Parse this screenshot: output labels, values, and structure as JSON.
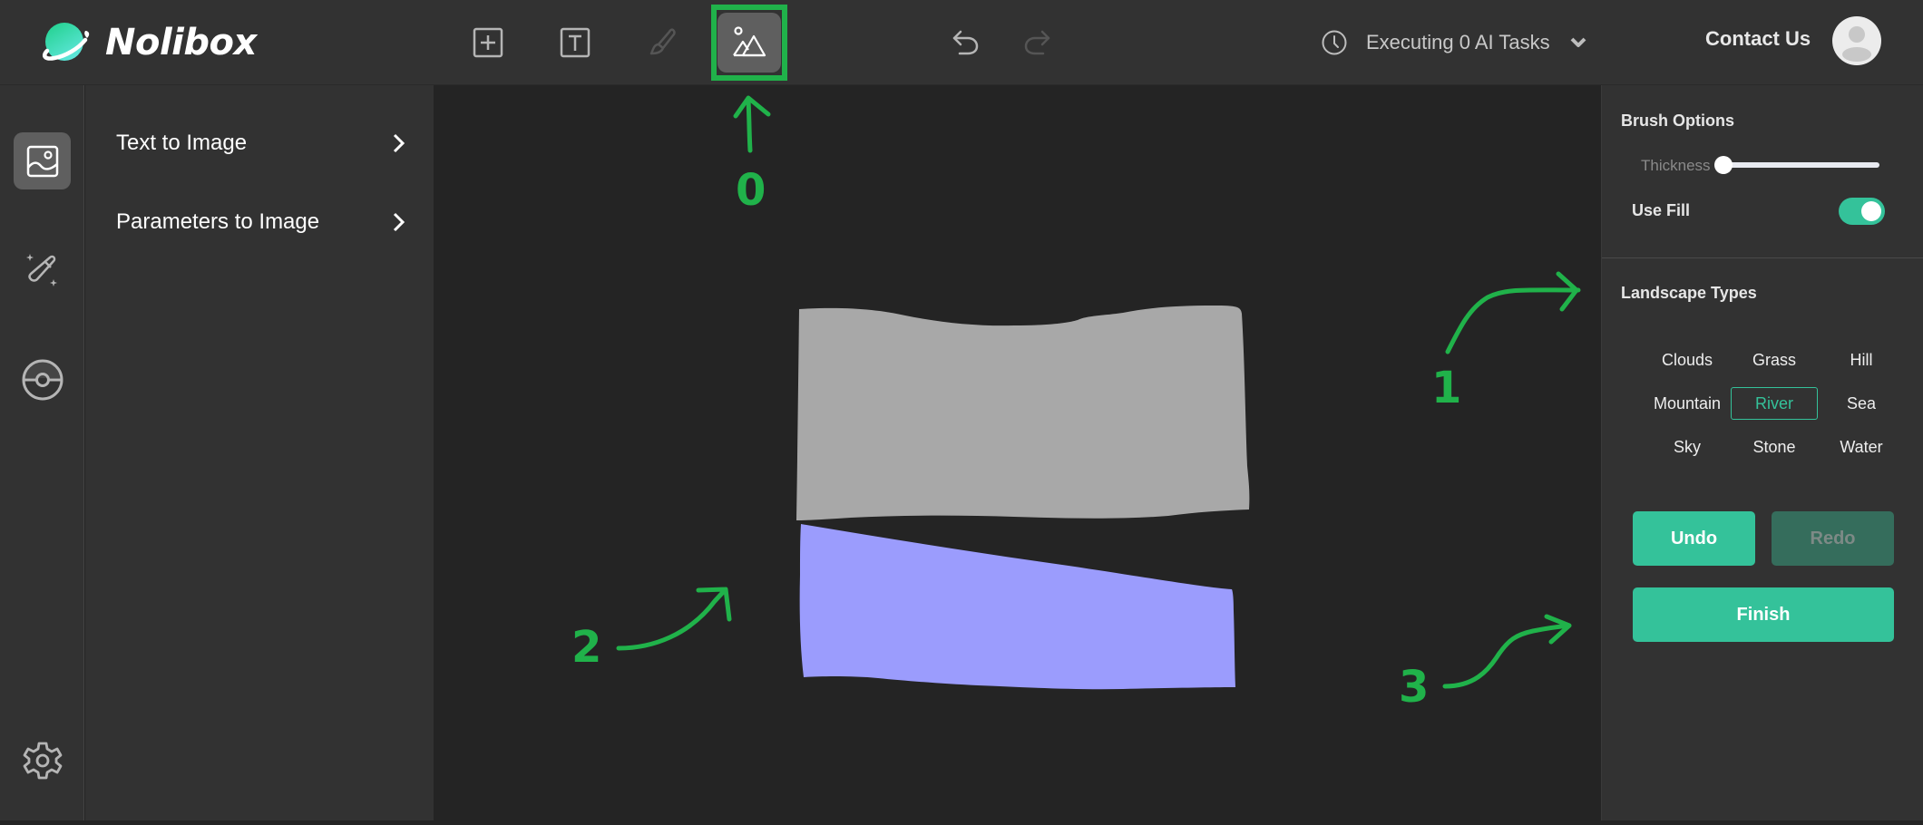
{
  "app": {
    "name": "Nolibox"
  },
  "toolbar": {
    "tools": [
      {
        "name": "add",
        "icon": "plus-square-icon",
        "active": false,
        "enabled": true
      },
      {
        "name": "text",
        "icon": "text-box-icon",
        "active": false,
        "enabled": true
      },
      {
        "name": "brush",
        "icon": "brush-icon",
        "active": false,
        "enabled": false
      },
      {
        "name": "landscape",
        "icon": "landscape-icon",
        "active": true,
        "enabled": true
      }
    ],
    "undo_icon": "undo-icon",
    "redo_icon": "redo-icon"
  },
  "header": {
    "tasks_label": "Executing 0 AI Tasks",
    "contact_label": "Contact Us"
  },
  "rail": {
    "items": [
      {
        "icon": "image-icon",
        "active": true
      },
      {
        "icon": "magic-wand-icon",
        "active": false
      },
      {
        "icon": "pokeball-icon",
        "active": false
      }
    ],
    "settings_icon": "gear-icon"
  },
  "left_panel": {
    "items": [
      {
        "label": "Text to Image"
      },
      {
        "label": "Parameters to Image"
      }
    ]
  },
  "canvas": {
    "shapes": [
      {
        "type": "Mountain",
        "color": "#a8a8a8"
      },
      {
        "type": "River",
        "color": "#9b9cfd"
      }
    ]
  },
  "right_panel": {
    "brush_title": "Brush Options",
    "thickness_label": "Thickness",
    "thickness_value_fraction": 0.0,
    "use_fill_label": "Use Fill",
    "use_fill": true,
    "landscape_title": "Landscape Types",
    "types": [
      "Clouds",
      "Grass",
      "Hill",
      "Mountain",
      "River",
      "Sea",
      "Sky",
      "Stone",
      "Water"
    ],
    "selected_type": "River",
    "undo_label": "Undo",
    "redo_label": "Redo",
    "finish_label": "Finish"
  },
  "annotations": {
    "color": "#20b24a",
    "labels": [
      "0",
      "1",
      "2",
      "3"
    ]
  },
  "colors": {
    "accent": "#34c29a",
    "accent_disabled": "#356d5c",
    "annotation": "#20b24a"
  }
}
